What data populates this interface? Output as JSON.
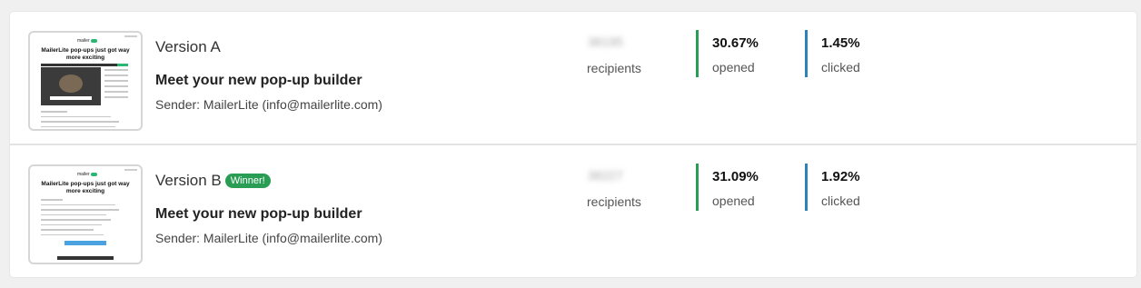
{
  "versions": [
    {
      "label": "Version A",
      "winner_badge": "",
      "subject": "Meet your new pop-up builder",
      "sender": "Sender: MailerLite (info@mailerlite.com)",
      "recipients_value": "38195",
      "recipients_label": "recipients",
      "opened_value": "30.67%",
      "opened_label": "opened",
      "clicked_value": "1.45%",
      "clicked_label": "clicked",
      "thumbnail": {
        "brand": "mailer",
        "headline": "MailerLite pop-ups just got way more exciting"
      }
    },
    {
      "label": "Version B",
      "winner_badge": "Winner!",
      "subject": "Meet your new pop-up builder",
      "sender": "Sender: MailerLite (info@mailerlite.com)",
      "recipients_value": "38227",
      "recipients_label": "recipients",
      "opened_value": "31.09%",
      "opened_label": "opened",
      "clicked_value": "1.92%",
      "clicked_label": "clicked",
      "thumbnail": {
        "brand": "mailer",
        "headline": "MailerLite pop-ups just got way more exciting"
      }
    }
  ],
  "colors": {
    "opened_accent": "#2a9d55",
    "clicked_accent": "#2d82b7",
    "winner_badge": "#2a9d55"
  }
}
